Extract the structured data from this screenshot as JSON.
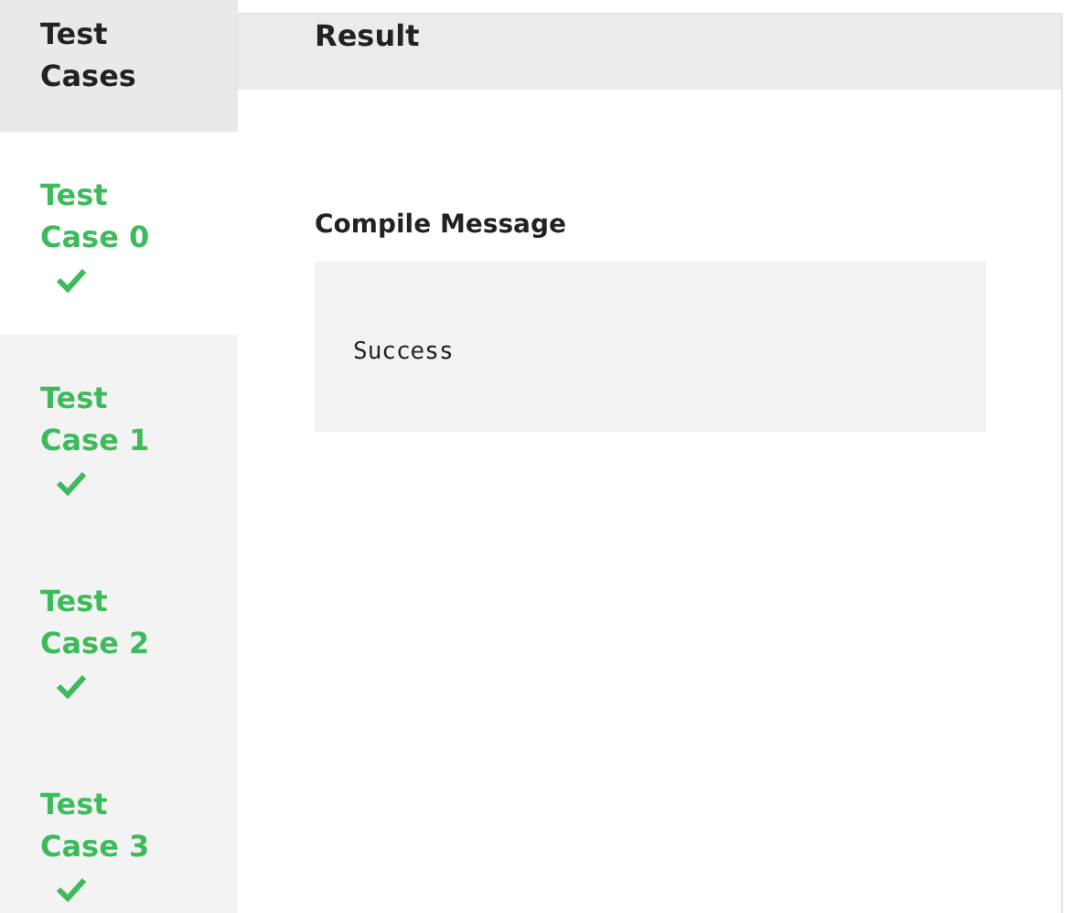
{
  "test_cases_heading": "Test Cases",
  "result_heading": "Result",
  "test_cases": [
    {
      "label": "Test Case 0",
      "selected": true,
      "passed": true
    },
    {
      "label": "Test Case 1",
      "selected": false,
      "passed": true
    },
    {
      "label": "Test Case 2",
      "selected": false,
      "passed": true
    },
    {
      "label": "Test Case 3",
      "selected": false,
      "passed": true
    }
  ],
  "compile_message": {
    "title": "Compile Message",
    "text": "Success"
  }
}
